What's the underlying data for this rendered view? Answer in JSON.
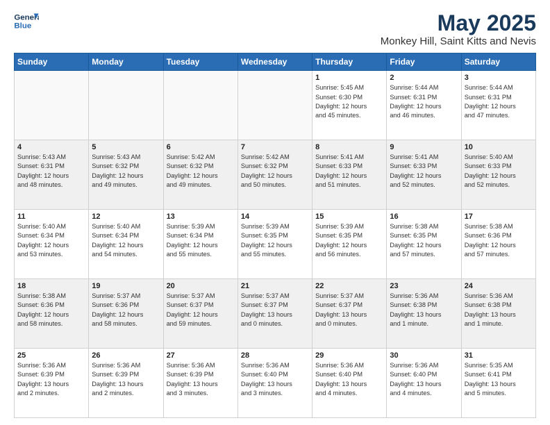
{
  "header": {
    "logo_line1": "General",
    "logo_line2": "Blue",
    "title": "May 2025",
    "subtitle": "Monkey Hill, Saint Kitts and Nevis"
  },
  "days_of_week": [
    "Sunday",
    "Monday",
    "Tuesday",
    "Wednesday",
    "Thursday",
    "Friday",
    "Saturday"
  ],
  "weeks": [
    [
      {
        "day": "",
        "info": ""
      },
      {
        "day": "",
        "info": ""
      },
      {
        "day": "",
        "info": ""
      },
      {
        "day": "",
        "info": ""
      },
      {
        "day": "1",
        "info": "Sunrise: 5:45 AM\nSunset: 6:30 PM\nDaylight: 12 hours\nand 45 minutes."
      },
      {
        "day": "2",
        "info": "Sunrise: 5:44 AM\nSunset: 6:31 PM\nDaylight: 12 hours\nand 46 minutes."
      },
      {
        "day": "3",
        "info": "Sunrise: 5:44 AM\nSunset: 6:31 PM\nDaylight: 12 hours\nand 47 minutes."
      }
    ],
    [
      {
        "day": "4",
        "info": "Sunrise: 5:43 AM\nSunset: 6:31 PM\nDaylight: 12 hours\nand 48 minutes."
      },
      {
        "day": "5",
        "info": "Sunrise: 5:43 AM\nSunset: 6:32 PM\nDaylight: 12 hours\nand 49 minutes."
      },
      {
        "day": "6",
        "info": "Sunrise: 5:42 AM\nSunset: 6:32 PM\nDaylight: 12 hours\nand 49 minutes."
      },
      {
        "day": "7",
        "info": "Sunrise: 5:42 AM\nSunset: 6:32 PM\nDaylight: 12 hours\nand 50 minutes."
      },
      {
        "day": "8",
        "info": "Sunrise: 5:41 AM\nSunset: 6:33 PM\nDaylight: 12 hours\nand 51 minutes."
      },
      {
        "day": "9",
        "info": "Sunrise: 5:41 AM\nSunset: 6:33 PM\nDaylight: 12 hours\nand 52 minutes."
      },
      {
        "day": "10",
        "info": "Sunrise: 5:40 AM\nSunset: 6:33 PM\nDaylight: 12 hours\nand 52 minutes."
      }
    ],
    [
      {
        "day": "11",
        "info": "Sunrise: 5:40 AM\nSunset: 6:34 PM\nDaylight: 12 hours\nand 53 minutes."
      },
      {
        "day": "12",
        "info": "Sunrise: 5:40 AM\nSunset: 6:34 PM\nDaylight: 12 hours\nand 54 minutes."
      },
      {
        "day": "13",
        "info": "Sunrise: 5:39 AM\nSunset: 6:34 PM\nDaylight: 12 hours\nand 55 minutes."
      },
      {
        "day": "14",
        "info": "Sunrise: 5:39 AM\nSunset: 6:35 PM\nDaylight: 12 hours\nand 55 minutes."
      },
      {
        "day": "15",
        "info": "Sunrise: 5:39 AM\nSunset: 6:35 PM\nDaylight: 12 hours\nand 56 minutes."
      },
      {
        "day": "16",
        "info": "Sunrise: 5:38 AM\nSunset: 6:35 PM\nDaylight: 12 hours\nand 57 minutes."
      },
      {
        "day": "17",
        "info": "Sunrise: 5:38 AM\nSunset: 6:36 PM\nDaylight: 12 hours\nand 57 minutes."
      }
    ],
    [
      {
        "day": "18",
        "info": "Sunrise: 5:38 AM\nSunset: 6:36 PM\nDaylight: 12 hours\nand 58 minutes."
      },
      {
        "day": "19",
        "info": "Sunrise: 5:37 AM\nSunset: 6:36 PM\nDaylight: 12 hours\nand 58 minutes."
      },
      {
        "day": "20",
        "info": "Sunrise: 5:37 AM\nSunset: 6:37 PM\nDaylight: 12 hours\nand 59 minutes."
      },
      {
        "day": "21",
        "info": "Sunrise: 5:37 AM\nSunset: 6:37 PM\nDaylight: 13 hours\nand 0 minutes."
      },
      {
        "day": "22",
        "info": "Sunrise: 5:37 AM\nSunset: 6:37 PM\nDaylight: 13 hours\nand 0 minutes."
      },
      {
        "day": "23",
        "info": "Sunrise: 5:36 AM\nSunset: 6:38 PM\nDaylight: 13 hours\nand 1 minute."
      },
      {
        "day": "24",
        "info": "Sunrise: 5:36 AM\nSunset: 6:38 PM\nDaylight: 13 hours\nand 1 minute."
      }
    ],
    [
      {
        "day": "25",
        "info": "Sunrise: 5:36 AM\nSunset: 6:39 PM\nDaylight: 13 hours\nand 2 minutes."
      },
      {
        "day": "26",
        "info": "Sunrise: 5:36 AM\nSunset: 6:39 PM\nDaylight: 13 hours\nand 2 minutes."
      },
      {
        "day": "27",
        "info": "Sunrise: 5:36 AM\nSunset: 6:39 PM\nDaylight: 13 hours\nand 3 minutes."
      },
      {
        "day": "28",
        "info": "Sunrise: 5:36 AM\nSunset: 6:40 PM\nDaylight: 13 hours\nand 3 minutes."
      },
      {
        "day": "29",
        "info": "Sunrise: 5:36 AM\nSunset: 6:40 PM\nDaylight: 13 hours\nand 4 minutes."
      },
      {
        "day": "30",
        "info": "Sunrise: 5:36 AM\nSunset: 6:40 PM\nDaylight: 13 hours\nand 4 minutes."
      },
      {
        "day": "31",
        "info": "Sunrise: 5:35 AM\nSunset: 6:41 PM\nDaylight: 13 hours\nand 5 minutes."
      }
    ]
  ]
}
